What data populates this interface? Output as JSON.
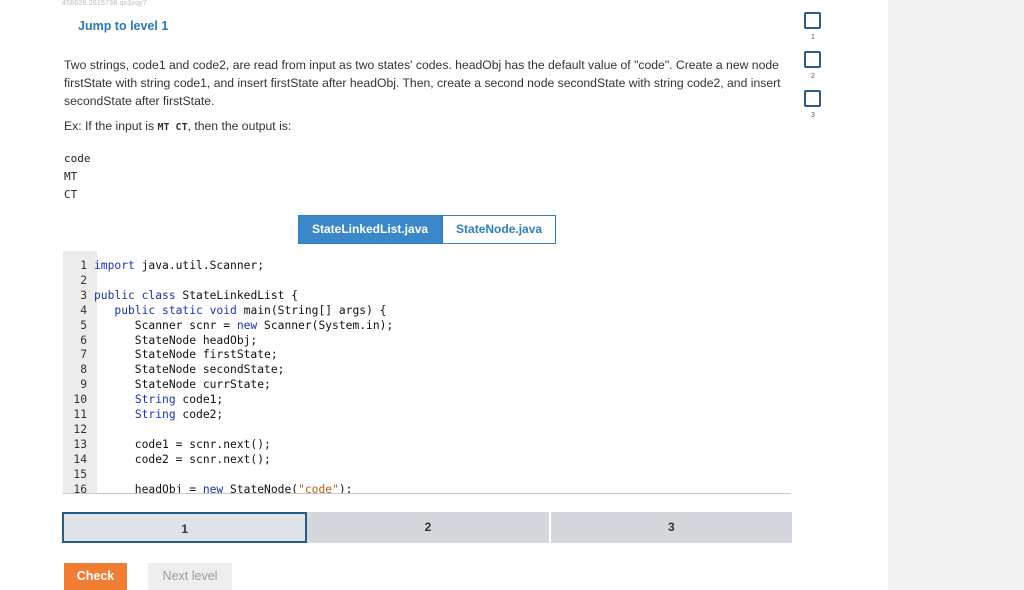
{
  "header": {
    "id_text": "458628.2615738.qx3zqy7",
    "jump_label": "Jump to level 1"
  },
  "prompt": {
    "text": "Two strings, code1 and code2, are read from input as two states' codes. headObj has the default value of \"code\". Create a new node firstState with string code1, and insert firstState after headObj. Then, create a second node secondState with string code2, and insert secondState after firstState.",
    "example_prefix": "Ex: If the input is ",
    "example_input": "MT CT",
    "example_suffix": ", then the output is:"
  },
  "expected_output": [
    "code",
    "MT",
    "CT"
  ],
  "tabs": [
    {
      "label": "StateLinkedList.java",
      "active": true
    },
    {
      "label": "StateNode.java",
      "active": false
    }
  ],
  "code": [
    {
      "n": "1",
      "tokens": [
        {
          "t": "import",
          "k": "kw"
        },
        {
          "t": " java.util.Scanner;"
        }
      ]
    },
    {
      "n": "2",
      "tokens": []
    },
    {
      "n": "3",
      "tokens": [
        {
          "t": "public class",
          "k": "kw"
        },
        {
          "t": " StateLinkedList {"
        }
      ]
    },
    {
      "n": "4",
      "tokens": [
        {
          "t": "   "
        },
        {
          "t": "public static void",
          "k": "kw"
        },
        {
          "t": " main(String[] args) {"
        }
      ]
    },
    {
      "n": "5",
      "tokens": [
        {
          "t": "      Scanner scnr = "
        },
        {
          "t": "new",
          "k": "kw"
        },
        {
          "t": " Scanner(System.in);"
        }
      ]
    },
    {
      "n": "6",
      "tokens": [
        {
          "t": "      StateNode headObj;"
        }
      ]
    },
    {
      "n": "7",
      "tokens": [
        {
          "t": "      StateNode firstState;"
        }
      ]
    },
    {
      "n": "8",
      "tokens": [
        {
          "t": "      StateNode secondState;"
        }
      ]
    },
    {
      "n": "9",
      "tokens": [
        {
          "t": "      StateNode currState;"
        }
      ]
    },
    {
      "n": "10",
      "tokens": [
        {
          "t": "      "
        },
        {
          "t": "String",
          "k": "kw"
        },
        {
          "t": " code1;"
        }
      ]
    },
    {
      "n": "11",
      "tokens": [
        {
          "t": "      "
        },
        {
          "t": "String",
          "k": "kw"
        },
        {
          "t": " code2;"
        }
      ]
    },
    {
      "n": "12",
      "tokens": []
    },
    {
      "n": "13",
      "tokens": [
        {
          "t": "      code1 = scnr.next();"
        }
      ]
    },
    {
      "n": "14",
      "tokens": [
        {
          "t": "      code2 = scnr.next();"
        }
      ]
    },
    {
      "n": "15",
      "tokens": []
    },
    {
      "n": "16",
      "tokens": [
        {
          "t": "      headObj = "
        },
        {
          "t": "new",
          "k": "kw"
        },
        {
          "t": " StateNode("
        },
        {
          "t": "\"code\"",
          "k": "str"
        },
        {
          "t": ");"
        }
      ]
    }
  ],
  "progress": [
    {
      "label": "1",
      "current": true
    },
    {
      "label": "2",
      "current": false
    },
    {
      "label": "3",
      "current": false
    }
  ],
  "buttons": {
    "check": "Check",
    "next": "Next level"
  },
  "levels": [
    "1",
    "2",
    "3"
  ]
}
